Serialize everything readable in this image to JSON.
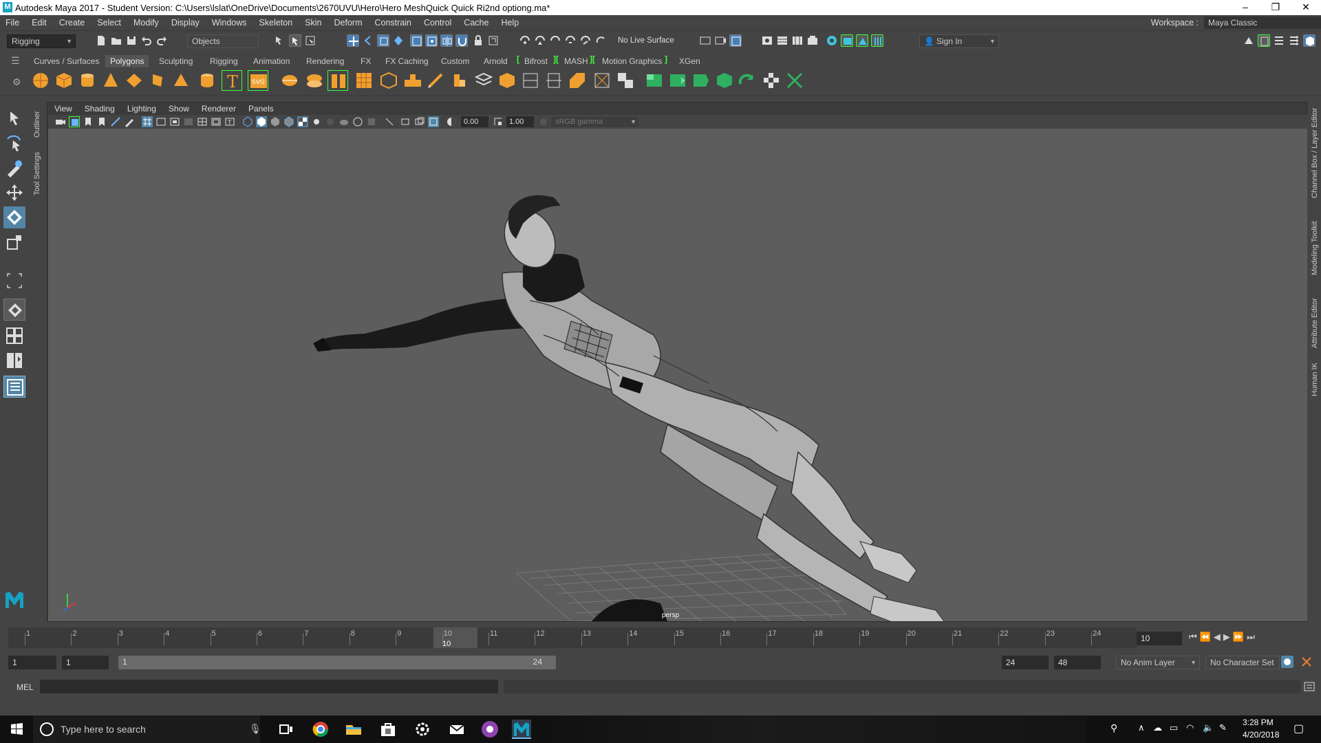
{
  "titlebar": {
    "title": "Autodesk Maya 2017 - Student Version: C:\\Users\\lslat\\OneDrive\\Documents\\2670UVU\\Hero\\Hero MeshQuick Quick Ri2nd optiong.ma*",
    "logo": "M",
    "minimize": "–",
    "restore": "❐",
    "close": "✕"
  },
  "menubar": {
    "items": [
      "File",
      "Edit",
      "Create",
      "Select",
      "Modify",
      "Display",
      "Windows",
      "Skeleton",
      "Skin",
      "Deform",
      "Constrain",
      "Control",
      "Cache",
      "Help"
    ],
    "workspace_label": "Workspace :",
    "workspace_value": "Maya Classic"
  },
  "statusline": {
    "menuset": "Rigging",
    "selection_mode": "Objects",
    "live_surface": "No Live Surface",
    "sign_in": "Sign In"
  },
  "shelf": {
    "tabs": [
      "Curves / Surfaces",
      "Polygons",
      "Sculpting",
      "Rigging",
      "Animation",
      "Rendering",
      "FX",
      "FX Caching",
      "Custom",
      "Arnold",
      "Bifrost",
      "MASH",
      "Motion Graphics",
      "XGen"
    ],
    "active_tab": "Polygons"
  },
  "viewport": {
    "menus": [
      "View",
      "Shading",
      "Lighting",
      "Show",
      "Renderer",
      "Panels"
    ],
    "exposure": "0.00",
    "gamma": "1.00",
    "color_space": "sRGB gamma",
    "camera_label": "persp"
  },
  "dock": {
    "left": [
      "Outliner",
      "Tool Settings"
    ],
    "right": [
      "Channel Box / Layer Editor",
      "Modeling Toolkit",
      "Attribute Editor",
      "Human IK"
    ]
  },
  "timeline": {
    "ticks": [
      "1",
      "2",
      "3",
      "4",
      "5",
      "6",
      "7",
      "8",
      "9",
      "10",
      "11",
      "12",
      "13",
      "14",
      "15",
      "16",
      "17",
      "18",
      "19",
      "20",
      "21",
      "22",
      "23",
      "24"
    ],
    "current_frame": "10",
    "current_frame_field": "10"
  },
  "range": {
    "start": "1",
    "start_inner": "1",
    "slider_start": "1",
    "slider_end": "24",
    "end_inner": "24",
    "end": "48",
    "anim_layer": "No Anim Layer",
    "character_set": "No Character Set"
  },
  "cmdline": {
    "label": "MEL"
  },
  "taskbar": {
    "search_placeholder": "Type here to search",
    "time": "3:28 PM",
    "date": "4/20/2018"
  },
  "colors": {
    "maya_accent": "#15a1c3",
    "shelf_highlight": "#3dff3d",
    "viewport_bg": "#5d5d5d",
    "panel_bg": "#444444"
  }
}
